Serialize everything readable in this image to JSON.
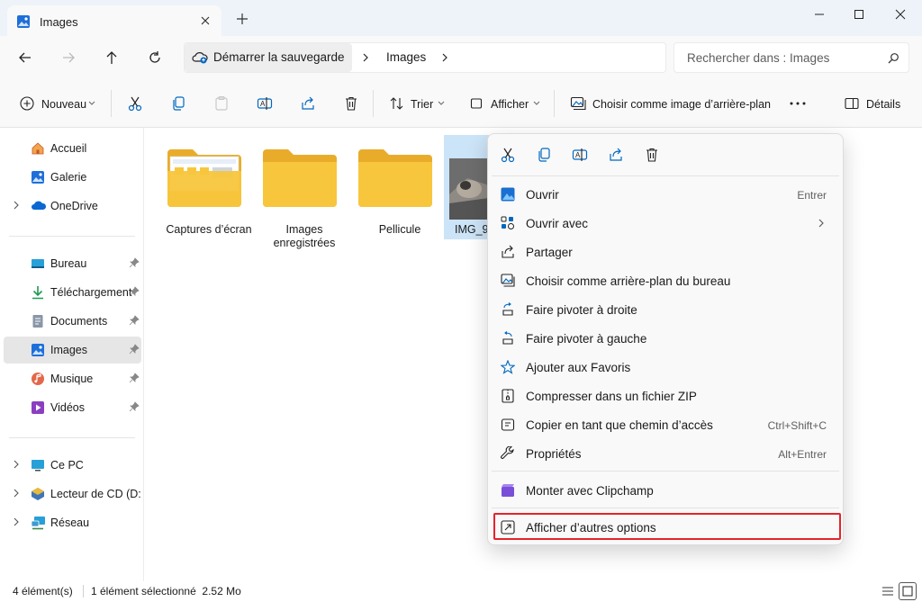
{
  "tab": {
    "title": "Images",
    "close_icon": "close-icon",
    "new_tab_icon": "plus-icon"
  },
  "window": {
    "minimize_icon": "minimize-icon",
    "maximize_icon": "maximize-icon",
    "close_icon": "close-icon"
  },
  "address": {
    "crumbs": [
      "Démarrer la sauvegarde",
      "Images"
    ],
    "search_placeholder": "Rechercher dans : Images"
  },
  "commands": {
    "new_label": "Nouveau",
    "sort_label": "Trier",
    "view_label": "Afficher",
    "wallpaper_label": "Choisir comme image d’arrière-plan",
    "details_label": "Détails"
  },
  "sidebar": {
    "items": [
      {
        "label": "Accueil",
        "icon": "home-icon"
      },
      {
        "label": "Galerie",
        "icon": "gallery-icon"
      },
      {
        "label": "OneDrive",
        "icon": "cloud-icon"
      },
      {
        "label": "Bureau",
        "icon": "desktop-icon"
      },
      {
        "label": "Téléchargement",
        "icon": "download-icon"
      },
      {
        "label": "Documents",
        "icon": "document-icon"
      },
      {
        "label": "Images",
        "icon": "images-icon"
      },
      {
        "label": "Musique",
        "icon": "music-icon"
      },
      {
        "label": "Vidéos",
        "icon": "video-icon"
      },
      {
        "label": "Ce PC",
        "icon": "pc-icon"
      },
      {
        "label": "Lecteur de CD (D:) V",
        "icon": "cd-drive-icon"
      },
      {
        "label": "Réseau",
        "icon": "network-icon"
      }
    ]
  },
  "files": [
    {
      "name": "Captures d’écran",
      "type": "folder"
    },
    {
      "name": "Images enregistrées",
      "type": "folder"
    },
    {
      "name": "Pellicule",
      "type": "folder"
    },
    {
      "name": "IMG_9",
      "type": "image"
    }
  ],
  "context_menu": {
    "items": [
      {
        "label": "Ouvrir",
        "shortcut": "Entrer"
      },
      {
        "label": "Ouvrir avec",
        "shortcut": ""
      },
      {
        "label": "Partager",
        "shortcut": ""
      },
      {
        "label": "Choisir comme arrière-plan du bureau",
        "shortcut": ""
      },
      {
        "label": "Faire pivoter à droite",
        "shortcut": ""
      },
      {
        "label": "Faire pivoter à gauche",
        "shortcut": ""
      },
      {
        "label": "Ajouter aux Favoris",
        "shortcut": ""
      },
      {
        "label": "Compresser dans un fichier ZIP",
        "shortcut": ""
      },
      {
        "label": "Copier en tant que chemin d’accès",
        "shortcut": "Ctrl+Shift+C"
      },
      {
        "label": "Propriétés",
        "shortcut": "Alt+Entrer"
      },
      {
        "label": "Monter avec Clipchamp",
        "shortcut": ""
      },
      {
        "label": "Afficher d’autres options",
        "shortcut": ""
      }
    ]
  },
  "status": {
    "count": "4 élément(s)",
    "selection": "1 élément sélectionné  2.52 Mo"
  },
  "colors": {
    "accent": "#0067c0",
    "highlight_box": "#e3242b",
    "folder": "#f8c63d"
  }
}
